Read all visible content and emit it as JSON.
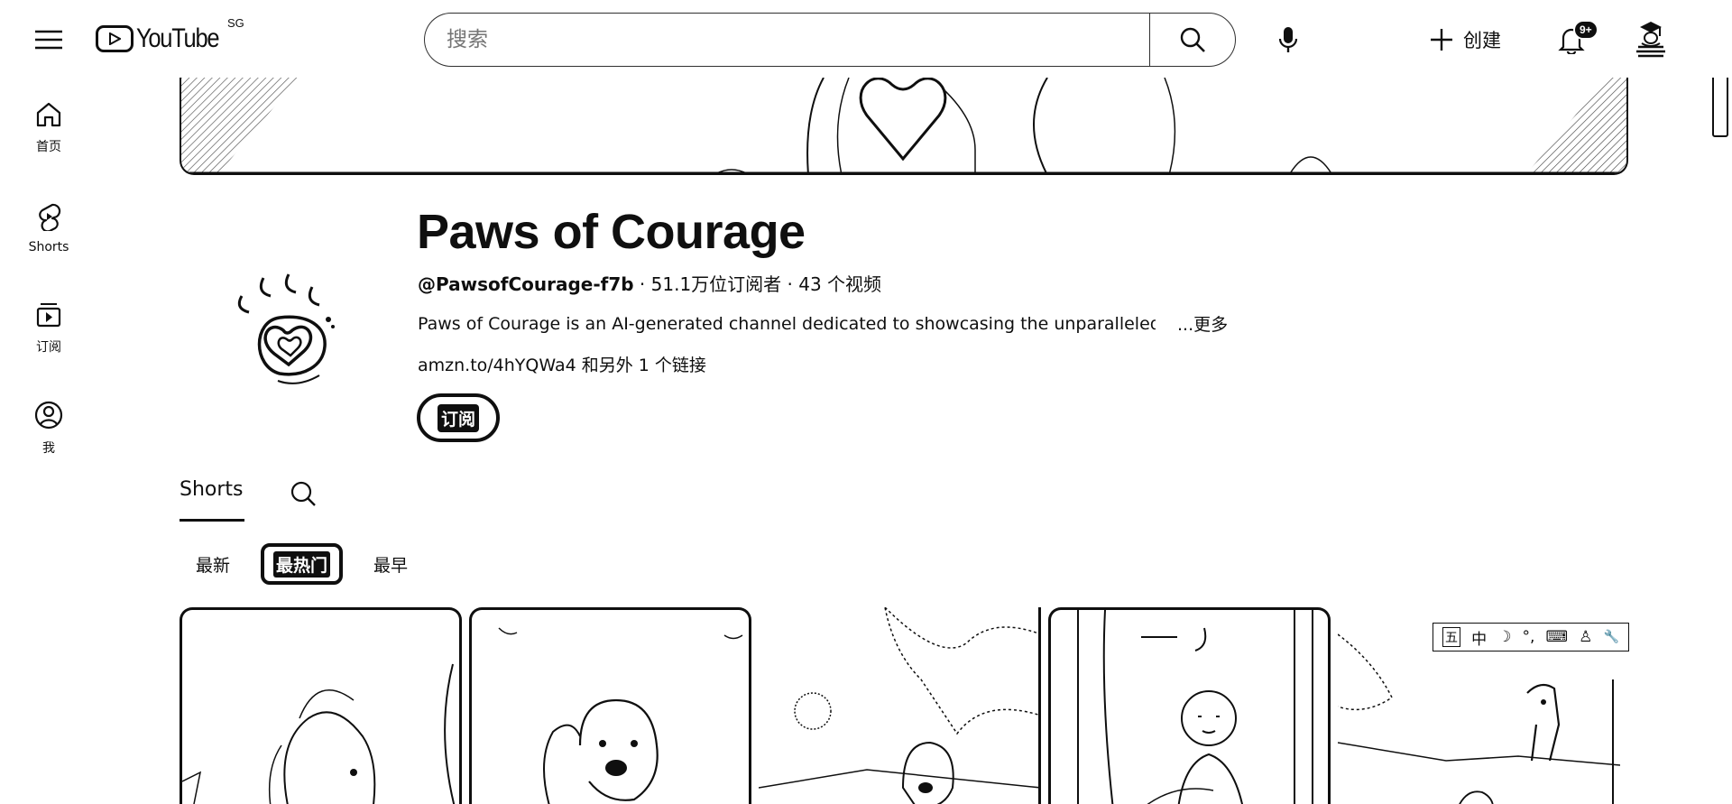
{
  "app": {
    "logo_text": "YouTube",
    "region": "SG"
  },
  "search": {
    "placeholder": "搜索"
  },
  "header": {
    "create_label": "创建",
    "notification_count": "9+"
  },
  "sidebar": {
    "items": [
      {
        "label": "首页",
        "icon": "home-icon"
      },
      {
        "label": "Shorts",
        "icon": "shorts-icon"
      },
      {
        "label": "订阅",
        "icon": "subscriptions-icon"
      },
      {
        "label": "我",
        "icon": "account-icon"
      }
    ]
  },
  "channel": {
    "name": "Paws of Courage",
    "handle": "@PawsofCourage-f7b",
    "stats": " · 51.1万位订阅者 · 43 个视频",
    "description": "Paws of Courage is an AI-generated channel dedicated to showcasing the unparalleled c",
    "more_label": "...更多",
    "links": "amzn.to/4hYQWa4 和另外 1 个链接",
    "subscribe_label": "订阅"
  },
  "tabs": {
    "shorts_label": "Shorts"
  },
  "chips": [
    "最新",
    "最热门",
    "最早"
  ],
  "ime_toolbar": {
    "items": [
      "五",
      "中",
      "☽",
      "°,",
      "⌨",
      "♙",
      "🔧"
    ]
  },
  "colors": {
    "ink": "#0f0f0f",
    "background": "#ffffff"
  }
}
